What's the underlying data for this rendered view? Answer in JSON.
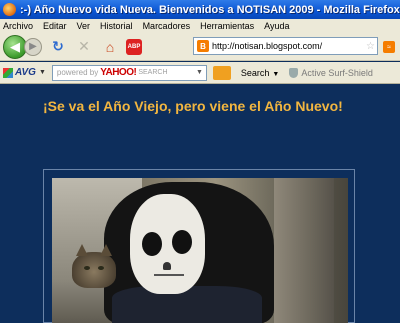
{
  "window": {
    "title": ":-)  Año Nuevo vida Nueva. Bienvenidos a NOTISAN 2009  - Mozilla Firefox"
  },
  "menu": [
    "Archivo",
    "Editar",
    "Ver",
    "Historial",
    "Marcadores",
    "Herramientas",
    "Ayuda"
  ],
  "navbar": {
    "url": "http://notisan.blogspot.com/",
    "abp_label": "ABP",
    "blogger_glyph": "B"
  },
  "avgbar": {
    "avg_label": "AVG",
    "search_powered": "powered by",
    "search_brand": "YAHOO!",
    "search_suffix": "SEARCH",
    "search_button": "Search",
    "shield_label": "Active Surf-Shield"
  },
  "post": {
    "title": "¡Se va el Año Viejo, pero viene el Año Nuevo!"
  },
  "colors": {
    "page_bg": "#0d2e5c",
    "title_color": "#f2b640"
  }
}
